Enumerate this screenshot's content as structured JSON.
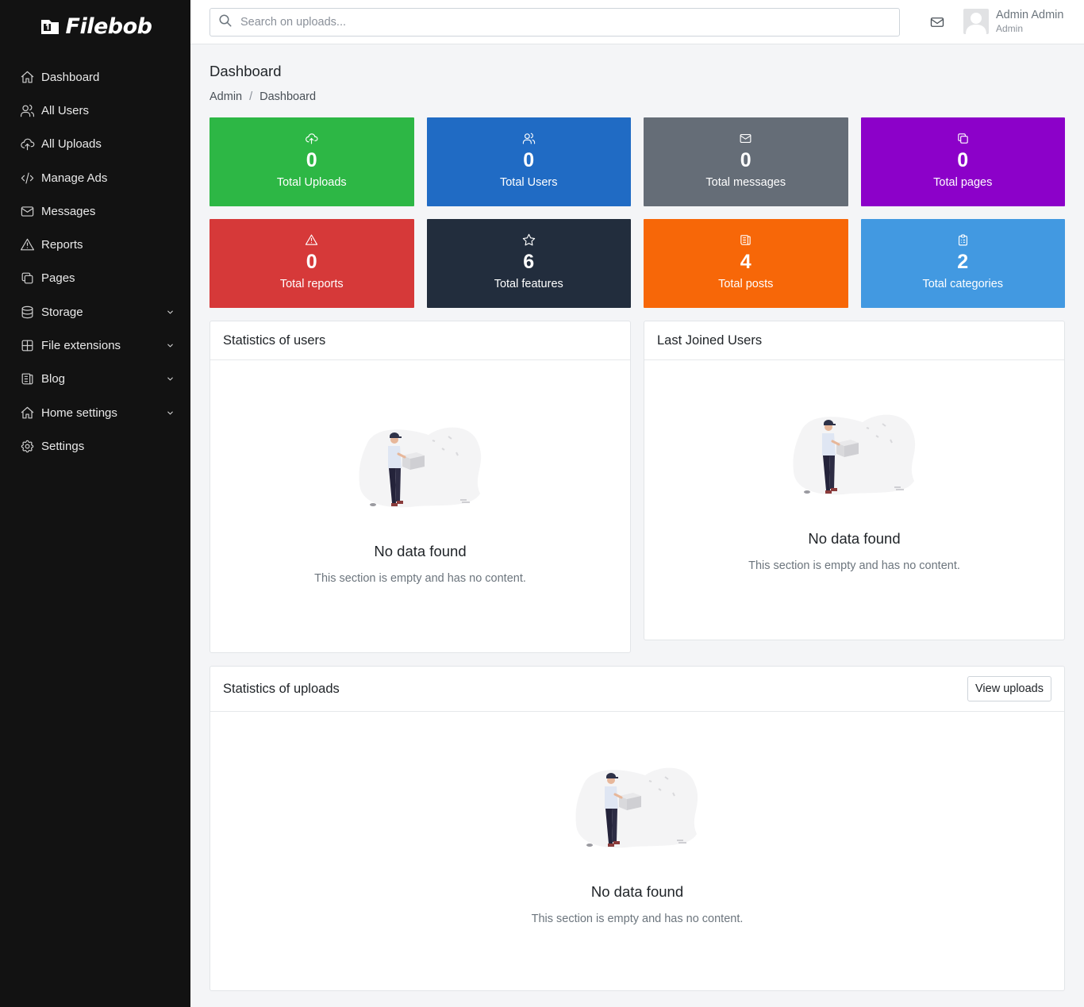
{
  "brand": {
    "name": "Filebob"
  },
  "sidebar": {
    "items": [
      {
        "label": "Dashboard",
        "icon": "home-icon",
        "has_submenu": false
      },
      {
        "label": "All Users",
        "icon": "users-icon",
        "has_submenu": false
      },
      {
        "label": "All Uploads",
        "icon": "cloud-upload-icon",
        "has_submenu": false
      },
      {
        "label": "Manage Ads",
        "icon": "code-icon",
        "has_submenu": false
      },
      {
        "label": "Messages",
        "icon": "mail-icon",
        "has_submenu": false
      },
      {
        "label": "Reports",
        "icon": "alert-triangle-icon",
        "has_submenu": false
      },
      {
        "label": "Pages",
        "icon": "copy-icon",
        "has_submenu": false
      },
      {
        "label": "Storage",
        "icon": "database-icon",
        "has_submenu": true
      },
      {
        "label": "File extensions",
        "icon": "grid-icon",
        "has_submenu": true
      },
      {
        "label": "Blog",
        "icon": "newspaper-icon",
        "has_submenu": true
      },
      {
        "label": "Home settings",
        "icon": "home-icon",
        "has_submenu": true
      },
      {
        "label": "Settings",
        "icon": "gear-icon",
        "has_submenu": false
      }
    ]
  },
  "topbar": {
    "search_placeholder": "Search on uploads...",
    "user": {
      "name": "Admin Admin",
      "role": "Admin"
    }
  },
  "page": {
    "title": "Dashboard",
    "breadcrumb": [
      "Admin",
      "Dashboard"
    ]
  },
  "stats": [
    {
      "value": "0",
      "label": "Total Uploads",
      "color": "#2db745",
      "icon": "cloud-upload-icon"
    },
    {
      "value": "0",
      "label": "Total Users",
      "color": "#206bc4",
      "icon": "users-icon"
    },
    {
      "value": "0",
      "label": "Total messages",
      "color": "#656d77",
      "icon": "mail-icon"
    },
    {
      "value": "0",
      "label": "Total pages",
      "color": "#8c01c9",
      "icon": "copy-icon"
    },
    {
      "value": "0",
      "label": "Total reports",
      "color": "#d63939",
      "icon": "alert-triangle-icon"
    },
    {
      "value": "6",
      "label": "Total features",
      "color": "#222d3d",
      "icon": "star-icon"
    },
    {
      "value": "4",
      "label": "Total posts",
      "color": "#f76708",
      "icon": "newspaper-icon"
    },
    {
      "value": "2",
      "label": "Total categories",
      "color": "#4299e1",
      "icon": "clipboard-icon"
    }
  ],
  "cards": {
    "users_stats": {
      "title": "Statistics of users",
      "empty_title": "No data found",
      "empty_text": "This section is empty and has no content."
    },
    "last_joined": {
      "title": "Last Joined Users",
      "empty_title": "No data found",
      "empty_text": "This section is empty and has no content."
    },
    "uploads_stats": {
      "title": "Statistics of uploads",
      "button": "View uploads",
      "empty_title": "No data found",
      "empty_text": "This section is empty and has no content."
    }
  }
}
